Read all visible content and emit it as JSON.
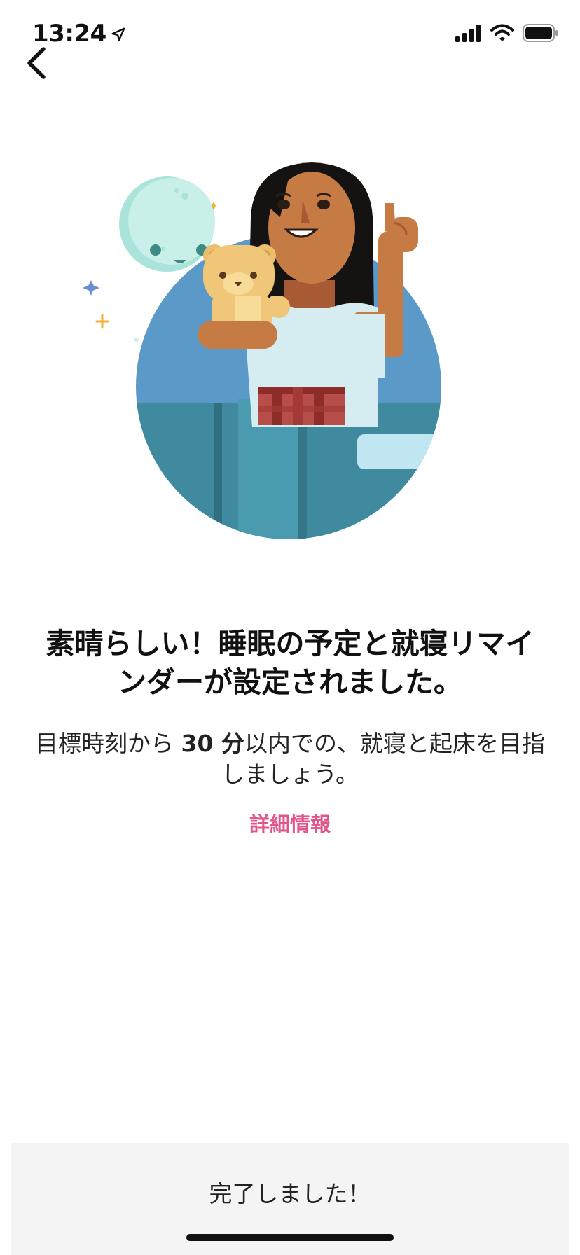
{
  "status_bar": {
    "time": "13:24",
    "icons": [
      "location-arrow-icon",
      "cellular-signal-icon",
      "wifi-icon",
      "battery-icon"
    ]
  },
  "nav": {
    "back_icon": "chevron-left-icon"
  },
  "hero": {
    "illustration": "woman-with-teddy-bear-and-moon-illustration"
  },
  "content": {
    "headline": "素晴らしい！睡眠の予定と就寝リマインダーが設定されました。",
    "subtext_before": "目標時刻から ",
    "subtext_number": "30 分",
    "subtext_after": "以内での、就寝と起床を目指しましょう。",
    "details_link": "詳細情報"
  },
  "footer": {
    "done_label": "完了しました！"
  },
  "colors": {
    "accent": "#e2558b",
    "footer_bg": "#f4f4f4",
    "circle_blue": "#5b9ac8",
    "teal_floor": "#3f8a9e",
    "moon": "#c8efe8"
  }
}
